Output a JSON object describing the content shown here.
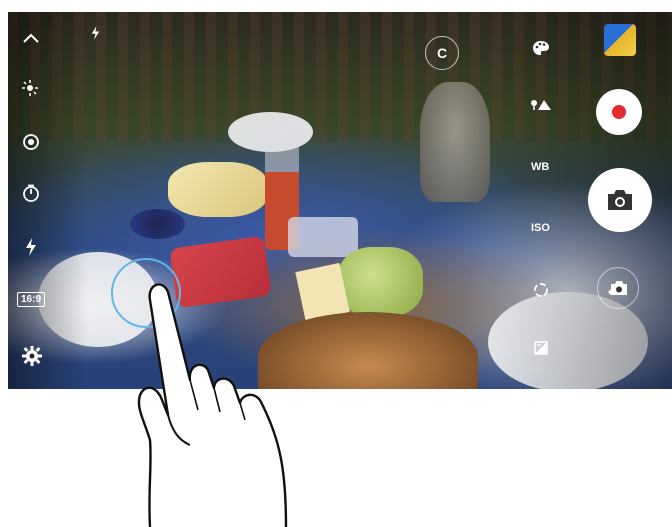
{
  "camera": {
    "left_toolbar": {
      "collapse_icon": "chevron-up-icon",
      "effect_icon": "effect-wand-icon",
      "focus_icon": "focus-target-icon",
      "timer_icon": "timer-icon",
      "flash_icon": "flash-icon",
      "aspect_ratio": "16:9",
      "settings_icon": "gear-icon"
    },
    "top_bar": {
      "flash_icon": "flash-icon",
      "mode_label": "C"
    },
    "pro_controls": {
      "color_icon": "palette-icon",
      "focus_icon": "mountain-flower-icon",
      "wb_label": "WB",
      "iso_label": "ISO",
      "shutter_speed_icon": "shutter-speed-icon",
      "exposure_icon": "exposure-icon"
    },
    "right_panel": {
      "gallery_icon": "gallery-thumbnail",
      "record_icon": "record-icon",
      "capture_icon": "camera-icon",
      "switch_icon": "switch-camera-icon"
    },
    "colors": {
      "record_red": "#e32b32",
      "focus_ring": "#5fb7e8"
    }
  }
}
